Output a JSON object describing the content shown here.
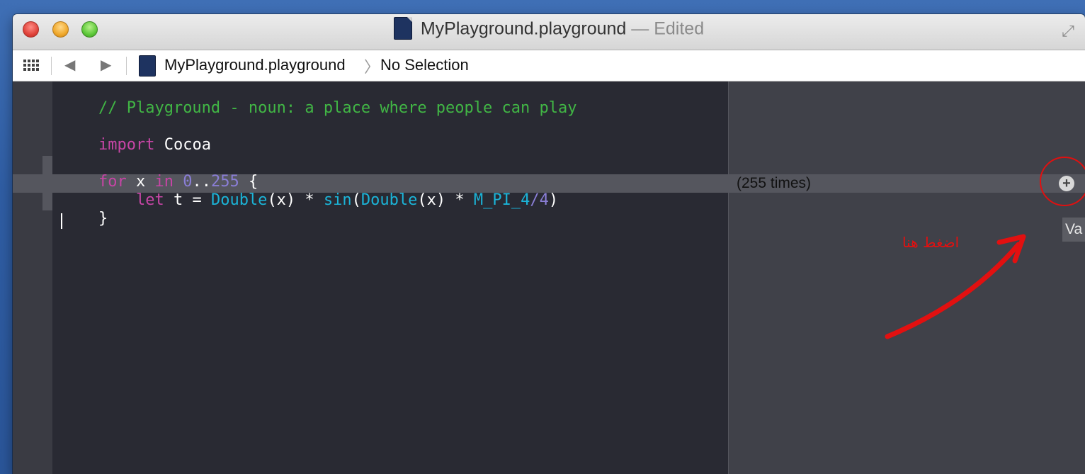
{
  "window": {
    "title": "MyPlayground.playground",
    "title_suffix": "— Edited"
  },
  "jumpbar": {
    "file": "MyPlayground.playground",
    "selection": "No Selection"
  },
  "code": {
    "line1": "// Playground - noun: a place where people can play",
    "line3_kw": "import",
    "line3_rest": " Cocoa",
    "line5": {
      "for": "for",
      "x": " x ",
      "in": "in",
      "sp": " ",
      "start": "0",
      "range": "..",
      "end": "255",
      "brace": " {"
    },
    "line6": {
      "indent": "    ",
      "let": "let",
      "t": " t = ",
      "double1": "Double",
      "x1": "(x) * ",
      "sin": "sin",
      "paren": "(",
      "double2": "Double",
      "x2": "(x) * ",
      "mpi": "M_PI_4",
      "slash": "/",
      "four": "4",
      "close": ")"
    },
    "line7": "}"
  },
  "results": {
    "line6": "(255 times)",
    "add_button": "+",
    "value_tab": "Va"
  },
  "annotation": {
    "label": "اضغط هنا",
    "color": "#e21010"
  },
  "colors": {
    "comment": "#41b645",
    "keyword": "#c745a6",
    "number": "#8a7ed6",
    "type": "#1bb4d8",
    "editor_bg": "#292a33"
  }
}
